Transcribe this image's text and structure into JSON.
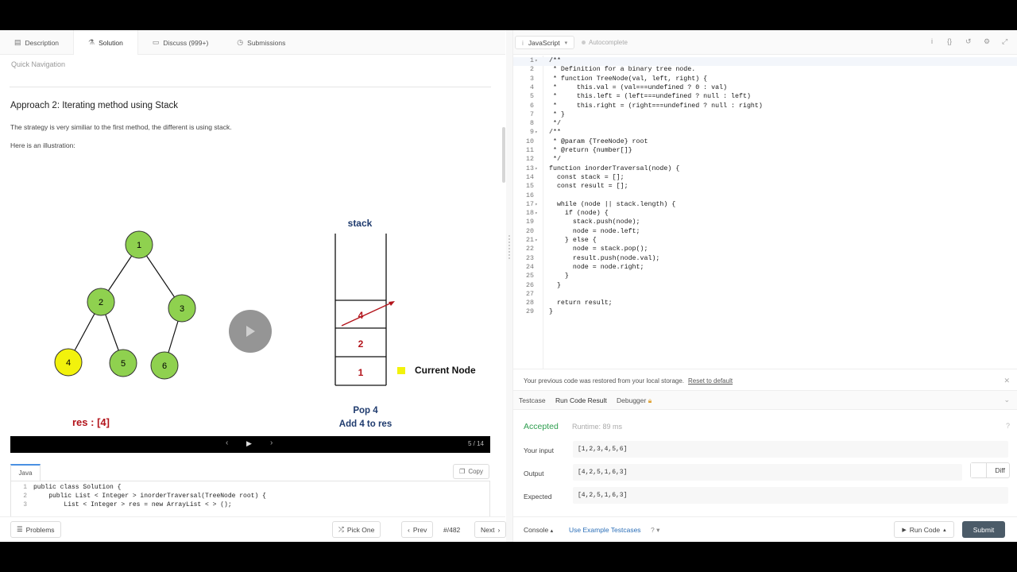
{
  "left_tabs": [
    {
      "label": "Description",
      "icon": "document-icon"
    },
    {
      "label": "Solution",
      "icon": "flask-icon"
    },
    {
      "label": "Discuss (999+)",
      "icon": "chat-icon"
    },
    {
      "label": "Submissions",
      "icon": "clock-icon"
    }
  ],
  "quick_nav": "Quick Navigation",
  "article": {
    "heading": "Approach 2: Iterating method using Stack",
    "para1": "The strategy is very similiar to the first method, the different is using stack.",
    "para2": "Here is an illustration:"
  },
  "illustration": {
    "stack_title": "stack",
    "stack_items": [
      "4",
      "2",
      "1"
    ],
    "tree_nodes": [
      "1",
      "2",
      "3",
      "4",
      "5",
      "6"
    ],
    "current_node": "4",
    "legend": "Current Node",
    "res": "res : [4]",
    "caption1": "Pop 4",
    "caption2": "Add 4 to res",
    "colors": {
      "node": "#8fd14f",
      "current": "#f2f20c",
      "accent": "#b3141b",
      "caption": "#1f3b6e"
    }
  },
  "player": {
    "prev": "‹",
    "play": "▶",
    "next": "›",
    "counter": "5 / 14"
  },
  "code_panel": {
    "language": "Java",
    "copy": "Copy",
    "lines": [
      {
        "n": "1",
        "text": "public class Solution {"
      },
      {
        "n": "2",
        "text": "    public List < Integer > inorderTraversal(TreeNode root) {"
      },
      {
        "n": "3",
        "text": "        List < Integer > res = new ArrayList < > ();"
      }
    ]
  },
  "bottom_left": {
    "problems": "Problems",
    "pick_one": "Pick One",
    "prev": "Prev",
    "counter": "/482",
    "next": "Next"
  },
  "editor": {
    "language": "JavaScript",
    "autocomplete": "Autocomplete",
    "toolbar_icons": [
      "info-icon",
      "braces-icon",
      "reset-icon",
      "settings-icon",
      "expand-icon"
    ],
    "lines": [
      {
        "n": "1",
        "fold": "▾",
        "text": "/**",
        "cls": "cm"
      },
      {
        "n": "2",
        "fold": "",
        "text": " * Definition for a binary tree node.",
        "cls": "cm"
      },
      {
        "n": "3",
        "fold": "",
        "text": " * function TreeNode(val, left, right) {",
        "cls": "cm"
      },
      {
        "n": "4",
        "fold": "",
        "text": " *     this.val = (val===undefined ? 0 : val)",
        "cls": "cm"
      },
      {
        "n": "5",
        "fold": "",
        "text": " *     this.left = (left===undefined ? null : left)",
        "cls": "cm"
      },
      {
        "n": "6",
        "fold": "",
        "text": " *     this.right = (right===undefined ? null : right)",
        "cls": "cm"
      },
      {
        "n": "7",
        "fold": "",
        "text": " * }",
        "cls": "cm"
      },
      {
        "n": "8",
        "fold": "",
        "text": " */",
        "cls": "cm"
      },
      {
        "n": "9",
        "fold": "▾",
        "text": "/**",
        "cls": "cm"
      },
      {
        "n": "10",
        "fold": "",
        "text": " * @param {TreeNode} root",
        "cls": "cm"
      },
      {
        "n": "11",
        "fold": "",
        "text": " * @return {number[]}",
        "cls": "cm"
      },
      {
        "n": "12",
        "fold": "",
        "text": " */",
        "cls": "cm"
      },
      {
        "n": "13",
        "fold": "▾",
        "text": "function inorderTraversal(node) {",
        "cls": ""
      },
      {
        "n": "14",
        "fold": "",
        "text": "  const stack = [];",
        "cls": ""
      },
      {
        "n": "15",
        "fold": "",
        "text": "  const result = [];",
        "cls": ""
      },
      {
        "n": "16",
        "fold": "",
        "text": "",
        "cls": ""
      },
      {
        "n": "17",
        "fold": "▾",
        "text": "  while (node || stack.length) {",
        "cls": ""
      },
      {
        "n": "18",
        "fold": "▾",
        "text": "    if (node) {",
        "cls": ""
      },
      {
        "n": "19",
        "fold": "",
        "text": "      stack.push(node);",
        "cls": ""
      },
      {
        "n": "20",
        "fold": "",
        "text": "      node = node.left;",
        "cls": ""
      },
      {
        "n": "21",
        "fold": "▾",
        "text": "    } else {",
        "cls": ""
      },
      {
        "n": "22",
        "fold": "",
        "text": "      node = stack.pop();",
        "cls": ""
      },
      {
        "n": "23",
        "fold": "",
        "text": "      result.push(node.val);",
        "cls": ""
      },
      {
        "n": "24",
        "fold": "",
        "text": "      node = node.right;",
        "cls": ""
      },
      {
        "n": "25",
        "fold": "",
        "text": "    }",
        "cls": ""
      },
      {
        "n": "26",
        "fold": "",
        "text": "  }",
        "cls": ""
      },
      {
        "n": "27",
        "fold": "",
        "text": "",
        "cls": ""
      },
      {
        "n": "28",
        "fold": "",
        "text": "  return result;",
        "cls": ""
      },
      {
        "n": "29",
        "fold": "",
        "text": "}",
        "cls": ""
      }
    ]
  },
  "restore": {
    "message": "Your previous code was restored from your local storage.",
    "link": "Reset to default"
  },
  "result_tabs": [
    "Testcase",
    "Run Code Result",
    "Debugger"
  ],
  "result": {
    "status": "Accepted",
    "runtime": "Runtime: 89 ms",
    "input_label": "Your input",
    "input": "[1,2,3,4,5,6]",
    "output_label": "Output",
    "output": "[4,2,5,1,6,3]",
    "expected_label": "Expected",
    "expected": "[4,2,5,1,6,3]",
    "diff": "Diff",
    "status_color": "#2e9e4f"
  },
  "bottom_right": {
    "console": "Console",
    "example": "Use Example Testcases",
    "run": "Run Code",
    "submit": "Submit"
  }
}
